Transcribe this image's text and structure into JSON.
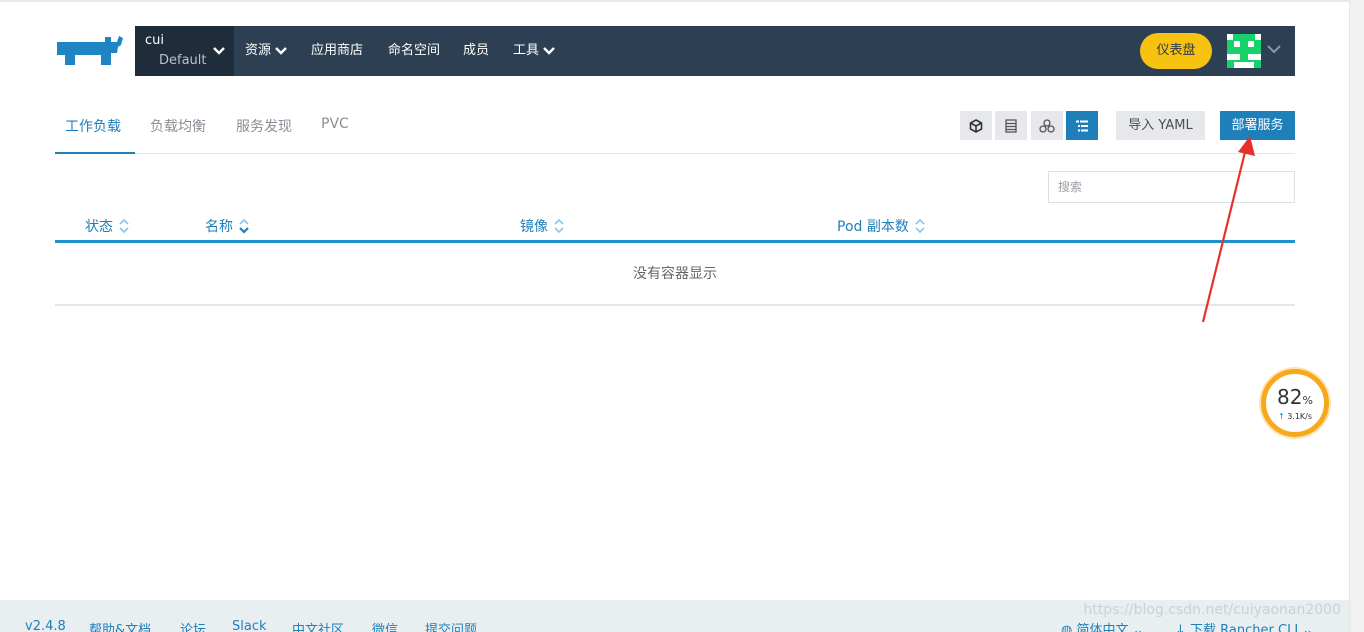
{
  "nav": {
    "cluster_name": "cui",
    "project_name": "Default",
    "items": [
      {
        "label": "资源",
        "dropdown": true
      },
      {
        "label": "应用商店",
        "dropdown": false
      },
      {
        "label": "命名空间",
        "dropdown": false
      },
      {
        "label": "成员",
        "dropdown": false
      },
      {
        "label": "工具",
        "dropdown": true
      }
    ],
    "dashboard_label": "仪表盘"
  },
  "tabs": [
    {
      "label": "工作负载",
      "active": true
    },
    {
      "label": "负载均衡",
      "active": false
    },
    {
      "label": "服务发现",
      "active": false
    },
    {
      "label": "PVC",
      "active": false
    }
  ],
  "toolbar": {
    "view_icons": [
      "cube-icon",
      "list-icon",
      "nodes-icon",
      "tree-list-icon"
    ],
    "active_view": "tree-list-icon",
    "import_yaml_label": "导入 YAML",
    "deploy_label": "部署服务"
  },
  "search": {
    "placeholder": "搜索",
    "value": ""
  },
  "table": {
    "columns": [
      "状态",
      "名称",
      "镜像",
      "Pod 副本数"
    ],
    "empty_text": "没有容器显示"
  },
  "speed_widget": {
    "percent": "82",
    "percent_unit": "%",
    "rate": "3.1K/s"
  },
  "footer": {
    "version": "v2.4.8",
    "links": [
      "帮助&文档",
      "论坛",
      "Slack",
      "中文社区",
      "微信",
      "提交问题"
    ],
    "language": "简体中文",
    "download": "下载 Rancher CLI"
  },
  "watermark": "https://blog.csdn.net/cuiyaonan2000",
  "colors": {
    "nav_bg": "#2d4053",
    "accent": "#1f7fb8",
    "dashboard": "#f7c310",
    "annotation": "#e8302a"
  }
}
